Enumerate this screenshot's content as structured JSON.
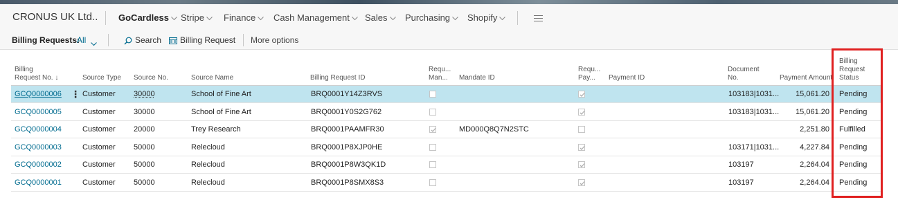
{
  "app": {
    "company": "CRONUS UK Ltd.."
  },
  "nav": {
    "items": [
      {
        "label": "GoCardless",
        "active": true
      },
      {
        "label": "Stripe",
        "active": false
      },
      {
        "label": "Finance",
        "active": false
      },
      {
        "label": "Cash Management",
        "active": false
      },
      {
        "label": "Sales",
        "active": false
      },
      {
        "label": "Purchasing",
        "active": false
      },
      {
        "label": "Shopify",
        "active": false
      }
    ],
    "menu_icon": "hamburger-icon"
  },
  "actionbar": {
    "title": "Billing Requests:",
    "filter": "All",
    "search": "Search",
    "billing_request": "Billing Request",
    "more": "More options"
  },
  "table": {
    "headers": {
      "billing_request_no_1": "Billing",
      "billing_request_no_2": "Request No. ↓",
      "source_type": "Source Type",
      "source_no": "Source No.",
      "source_name": "Source Name",
      "billing_request_id": "Billing Request ID",
      "req_man_1": "Requ...",
      "req_man_2": "Man...",
      "mandate_id": "Mandate ID",
      "req_pay_1": "Requ...",
      "req_pay_2": "Pay...",
      "payment_id": "Payment ID",
      "document_no_1": "Document",
      "document_no_2": "No.",
      "payment_amount": "Payment Amount",
      "status_1": "Billing",
      "status_2": "Request",
      "status_3": "Status"
    },
    "rows": [
      {
        "no": "GCQ0000006",
        "source_type": "Customer",
        "source_no": "30000",
        "source_name": "School of Fine Art",
        "br_id": "BRQ0001Y14Z3RVS",
        "req_man": false,
        "mandate_id": "",
        "req_pay": true,
        "payment_id": "",
        "doc_no": "103183|1031...",
        "amount": "15,061.20",
        "status": "Pending",
        "selected": true
      },
      {
        "no": "GCQ0000005",
        "source_type": "Customer",
        "source_no": "30000",
        "source_name": "School of Fine Art",
        "br_id": "BRQ0001Y0S2G762",
        "req_man": false,
        "mandate_id": "",
        "req_pay": true,
        "payment_id": "",
        "doc_no": "103183|1031...",
        "amount": "15,061.20",
        "status": "Pending",
        "selected": false
      },
      {
        "no": "GCQ0000004",
        "source_type": "Customer",
        "source_no": "20000",
        "source_name": "Trey Research",
        "br_id": "BRQ0001PAAMFR30",
        "req_man": true,
        "mandate_id": "MD000Q8Q7N2STC",
        "req_pay": false,
        "payment_id": "",
        "doc_no": "",
        "amount": "2,251.80",
        "status": "Fulfilled",
        "selected": false
      },
      {
        "no": "GCQ0000003",
        "source_type": "Customer",
        "source_no": "50000",
        "source_name": "Relecloud",
        "br_id": "BRQ0001P8XJP0HE",
        "req_man": false,
        "mandate_id": "",
        "req_pay": true,
        "payment_id": "",
        "doc_no": "103171|1031...",
        "amount": "4,227.84",
        "status": "Pending",
        "selected": false
      },
      {
        "no": "GCQ0000002",
        "source_type": "Customer",
        "source_no": "50000",
        "source_name": "Relecloud",
        "br_id": "BRQ0001P8W3QK1D",
        "req_man": false,
        "mandate_id": "",
        "req_pay": true,
        "payment_id": "",
        "doc_no": "103197",
        "amount": "2,264.04",
        "status": "Pending",
        "selected": false
      },
      {
        "no": "GCQ0000001",
        "source_type": "Customer",
        "source_no": "50000",
        "source_name": "Relecloud",
        "br_id": "BRQ0001P8SMX8S3",
        "req_man": false,
        "mandate_id": "",
        "req_pay": true,
        "payment_id": "",
        "doc_no": "103197",
        "amount": "2,264.04",
        "status": "Pending",
        "selected": false
      }
    ]
  },
  "colors": {
    "accent": "#006b8f",
    "selected_row": "#bfe4ef",
    "highlight_box": "#e02020"
  }
}
